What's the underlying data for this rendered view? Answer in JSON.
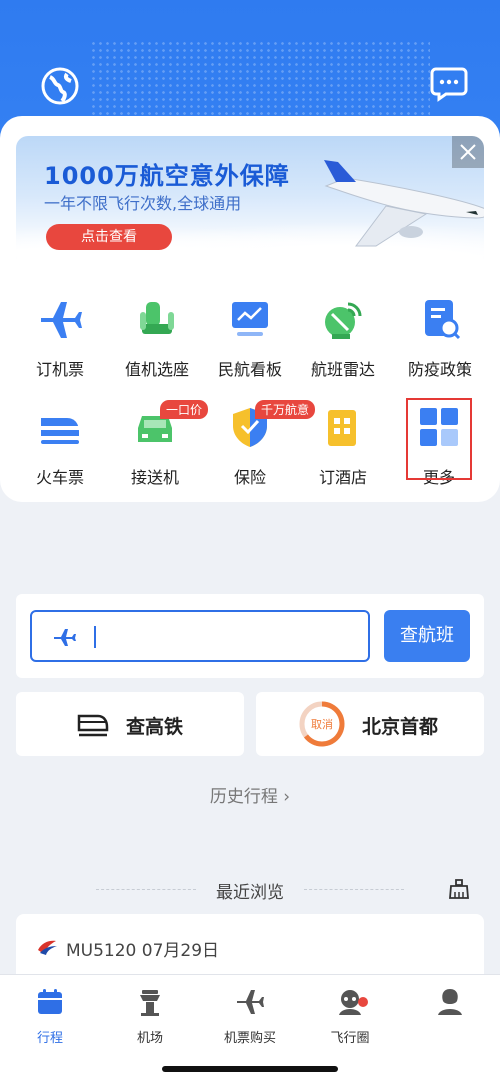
{
  "header": {
    "left_icon": "globe-icon",
    "right_icon": "message-bubble-icon",
    "accent_color": "#3381f3"
  },
  "banner": {
    "title": "1000万航空意外保障",
    "subtitle": "一年不限飞行次数,全球通用",
    "button_label": "点击查看"
  },
  "services": [
    {
      "label": "订机票",
      "icon": "airplane-icon"
    },
    {
      "label": "值机选座",
      "icon": "seat-icon"
    },
    {
      "label": "民航看板",
      "icon": "dashboard-icon"
    },
    {
      "label": "航班雷达",
      "icon": "radar-icon"
    },
    {
      "label": "防疫政策",
      "icon": "policy-document-icon"
    },
    {
      "label": "火车票",
      "icon": "train-icon"
    },
    {
      "label": "接送机",
      "icon": "car-icon",
      "badge": "一口价"
    },
    {
      "label": "保险",
      "icon": "shield-icon",
      "badge": "千万航意"
    },
    {
      "label": "订酒店",
      "icon": "hotel-icon"
    },
    {
      "label": "更多",
      "icon": "more-grid-icon"
    }
  ],
  "search": {
    "placeholder": "",
    "button_label": "查航班"
  },
  "quick_links": {
    "rail_label": "查高铁",
    "airport_status": "取消",
    "airport_label": "北京首都"
  },
  "history_label": "历史行程 ›",
  "recent": {
    "title": "最近浏览",
    "item": "MU5120 07月29日"
  },
  "tabbar": [
    {
      "label": "行程",
      "icon": "calendar-icon",
      "active": true
    },
    {
      "label": "机场",
      "icon": "control-tower-icon"
    },
    {
      "label": "机票购买",
      "icon": "airplane-icon"
    },
    {
      "label": "飞行圈",
      "icon": "community-icon",
      "dot": true
    },
    {
      "label": "",
      "icon": "profile-icon"
    }
  ]
}
